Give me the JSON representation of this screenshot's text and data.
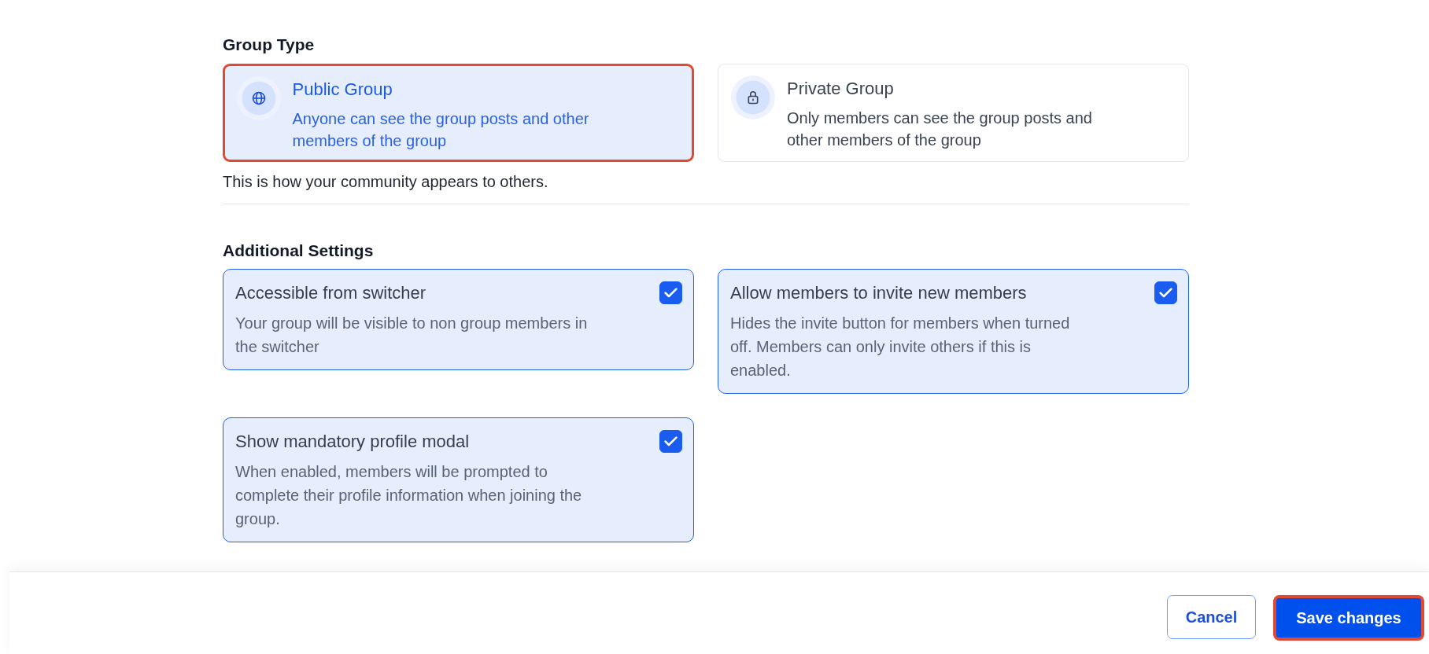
{
  "group_type": {
    "heading": "Group Type",
    "options": [
      {
        "kind": "public",
        "title": "Public Group",
        "description": "Anyone can see the group posts and other members of the group",
        "selected": true,
        "highlighted": true
      },
      {
        "kind": "private",
        "title": "Private Group",
        "description": "Only members can see the group posts and other members of the group",
        "selected": false,
        "highlighted": false
      }
    ],
    "hint": "This is how your community appears to others."
  },
  "additional_settings": {
    "heading": "Additional Settings",
    "items": [
      {
        "title": "Accessible from switcher",
        "description": "Your group will be visible to non group members in the switcher",
        "checked": true
      },
      {
        "title": "Allow members to invite new members",
        "description": "Hides the invite button for members when turned off. Members can only invite others if this is enabled.",
        "checked": true
      },
      {
        "title": "Show mandatory profile modal",
        "description": "When enabled, members will be prompted to complete their profile information when joining the group.",
        "checked": true
      }
    ]
  },
  "footer": {
    "buttons": [
      {
        "kind": "secondary",
        "label": "Cancel",
        "highlighted": false
      },
      {
        "kind": "primary",
        "label": "Save changes",
        "highlighted": true
      }
    ]
  }
}
